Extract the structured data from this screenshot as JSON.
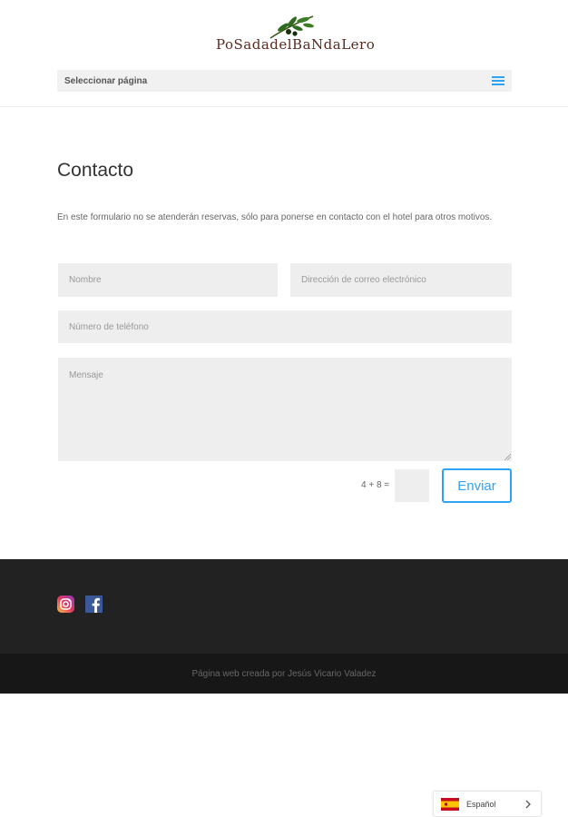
{
  "header": {
    "logo_text": "PoSadadelBaNdaLero",
    "nav_select_label": "Seleccionar página",
    "menu_icon": "hamburger-menu-icon"
  },
  "main": {
    "title": "Contacto",
    "intro": "En este formulario no se atenderán reservas, sólo para ponerse en contacto con el hotel para otros motivos.",
    "form": {
      "name_placeholder": "Nombre",
      "email_placeholder": "Dirección de correo electrónico",
      "phone_placeholder": "Número de teléfono",
      "message_placeholder": "Mensaje",
      "captcha_question": "4 + 8 =",
      "captcha_value": "",
      "submit_label": "Enviar"
    }
  },
  "footer": {
    "social": [
      "instagram-icon",
      "facebook-icon"
    ],
    "credits": "Página web creada por Jesús Vicario Valadez"
  },
  "language_switcher": {
    "label": "Español",
    "flag": "spain-flag-icon"
  },
  "colors": {
    "accent": "#2ea3f2",
    "field_bg": "#eeeeee",
    "footer_bg": "#222222",
    "footer_bottom_bg": "#171717"
  }
}
